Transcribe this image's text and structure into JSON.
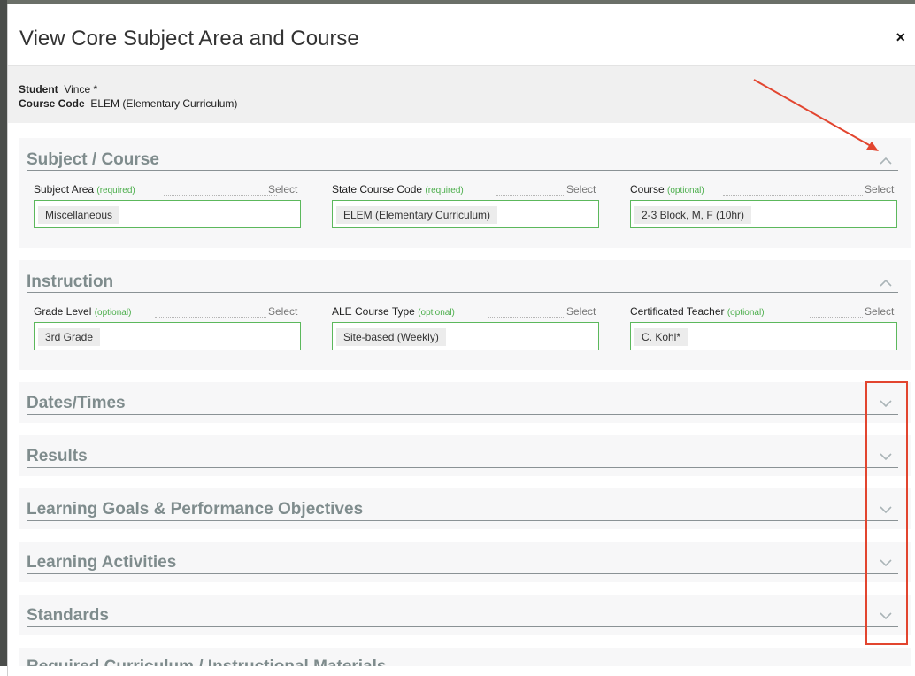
{
  "modal": {
    "title": "View Core Subject Area and Course",
    "close_icon": "×"
  },
  "info": {
    "student_label": "Student",
    "student_value": "Vince *",
    "course_code_label": "Course Code",
    "course_code_value": "ELEM (Elementary Curriculum)"
  },
  "sections": {
    "subject_course": {
      "title": "Subject / Course",
      "expanded": true,
      "fields": [
        {
          "label": "Subject Area",
          "qualifier": "(required)",
          "select": "Select",
          "value": "Miscellaneous"
        },
        {
          "label": "State Course Code",
          "qualifier": "(required)",
          "select": "Select",
          "value": "ELEM (Elementary Curriculum)"
        },
        {
          "label": "Course",
          "qualifier": "(optional)",
          "select": "Select",
          "value": "2-3 Block, M, F (10hr)"
        }
      ]
    },
    "instruction": {
      "title": "Instruction",
      "expanded": true,
      "fields": [
        {
          "label": "Grade Level",
          "qualifier": "(optional)",
          "select": "Select",
          "value": "3rd Grade"
        },
        {
          "label": "ALE Course Type",
          "qualifier": "(optional)",
          "select": "Select",
          "value": "Site-based (Weekly)"
        },
        {
          "label": "Certificated Teacher",
          "qualifier": "(optional)",
          "select": "Select",
          "value": "C. Kohl*"
        }
      ]
    },
    "dates_times": {
      "title": "Dates/Times",
      "expanded": false
    },
    "results": {
      "title": "Results",
      "expanded": false
    },
    "learning_goals": {
      "title": "Learning Goals & Performance Objectives",
      "expanded": false
    },
    "learning_activities": {
      "title": "Learning Activities",
      "expanded": false
    },
    "standards": {
      "title": "Standards",
      "expanded": false
    },
    "required_curriculum": {
      "title": "Required Curriculum / Instructional Materials",
      "expanded": false
    }
  },
  "colors": {
    "section_title": "#7f8c8d",
    "field_border": "#5cb85c",
    "qualifier": "#4cae4c",
    "annotation": "#e2452f"
  }
}
